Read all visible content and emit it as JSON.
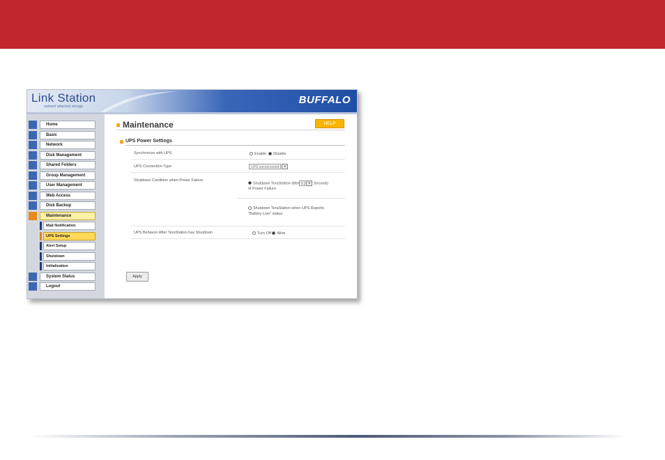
{
  "colors": {
    "header_red": "#c1272d",
    "nav_icon_blue": "#3d67b3",
    "active_orange": "#e8891c",
    "help_yellow": "#f7b500"
  },
  "app": {
    "logo_main": "Link Station",
    "logo_sub": "network attached storage",
    "brand": "BUFFALO"
  },
  "nav": {
    "items": [
      {
        "label": "Home",
        "icon": "home-icon"
      },
      {
        "label": "Basic",
        "icon": "basic-icon"
      },
      {
        "label": "Network",
        "icon": "network-icon"
      },
      {
        "label": "Disk Management",
        "icon": "disk-icon"
      },
      {
        "label": "Shared Folders",
        "icon": "folder-icon"
      },
      {
        "label": "Group Management",
        "icon": "group-icon"
      },
      {
        "label": "User Management",
        "icon": "user-icon"
      },
      {
        "label": "Web Access",
        "icon": "web-icon"
      },
      {
        "label": "Disk Backup",
        "icon": "backup-icon"
      },
      {
        "label": "Maintenance",
        "icon": "tools-icon"
      },
      {
        "label": "System Status",
        "icon": "status-icon"
      },
      {
        "label": "Logout",
        "icon": "logout-icon"
      }
    ],
    "sub_items": [
      {
        "label": "Mail Notification"
      },
      {
        "label": "UPS Settings"
      },
      {
        "label": "Alert Setup"
      },
      {
        "label": "Shutdown"
      },
      {
        "label": "Initialization"
      }
    ]
  },
  "content": {
    "title": "Maintenance",
    "help": "HELP",
    "section": "UPS Power Settings",
    "rows": {
      "sync": {
        "label": "Synchronize with UPS",
        "opt1": "Enable",
        "opt2": "Disable"
      },
      "conn": {
        "label": "UPS Connection Type",
        "value": "UPS unconnected"
      },
      "shutdown": {
        "label": "Shutdown Condition when Power Failure",
        "opt1_pre": "Shutdown TeraStation after",
        "opt1_value": "5",
        "opt1_post": "Seconds",
        "opt1_post2": "of Power Failure.",
        "opt2_line1": "Shutdown TeraStation when UPS Reports",
        "opt2_line2": "\"Battery Low\" status."
      },
      "behavior": {
        "label": "UPS Behavior After TeraStation has Shutdown",
        "opt1": "Turn Off",
        "opt2": "Alive"
      }
    },
    "apply": "Apply"
  }
}
